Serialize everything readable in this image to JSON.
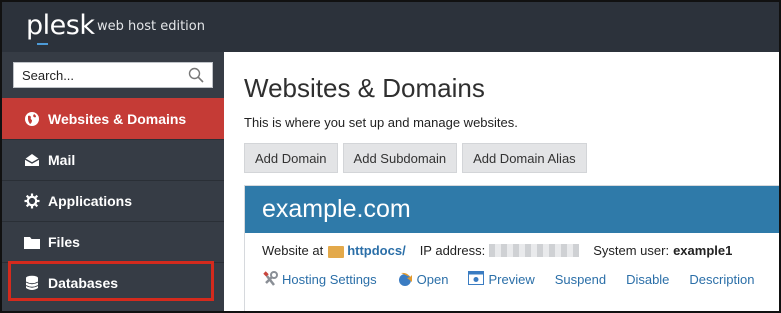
{
  "header": {
    "logo": "plesk",
    "edition": "web host edition"
  },
  "sidebar": {
    "search_placeholder": "Search...",
    "items": [
      {
        "label": "Websites & Domains",
        "icon": "globe-icon",
        "active": true
      },
      {
        "label": "Mail",
        "icon": "mail-icon"
      },
      {
        "label": "Applications",
        "icon": "gear-icon"
      },
      {
        "label": "Files",
        "icon": "folder-icon"
      },
      {
        "label": "Databases",
        "icon": "database-icon"
      }
    ]
  },
  "main": {
    "title": "Websites & Domains",
    "description": "This is where you set up and manage websites.",
    "buttons": [
      "Add Domain",
      "Add Subdomain",
      "Add Domain Alias"
    ],
    "domain": {
      "name": "example.com",
      "website_at_label": "Website at",
      "docroot": "httpdocs/",
      "ip_label": "IP address:",
      "system_user_label": "System user:",
      "system_user": "example1",
      "actions": [
        {
          "label": "Hosting Settings",
          "icon": "wrench-icon"
        },
        {
          "label": "Open",
          "icon": "open-link-icon"
        },
        {
          "label": "Preview",
          "icon": "preview-icon"
        },
        {
          "label": "Suspend"
        },
        {
          "label": "Disable"
        },
        {
          "label": "Description"
        }
      ]
    }
  },
  "colors": {
    "topbar": "#2c323b",
    "sidebar": "#363c45",
    "active_item": "#c53b36",
    "domain_header": "#2f7aa9",
    "link": "#2b6fa8",
    "highlight_box": "#d42a1d"
  }
}
